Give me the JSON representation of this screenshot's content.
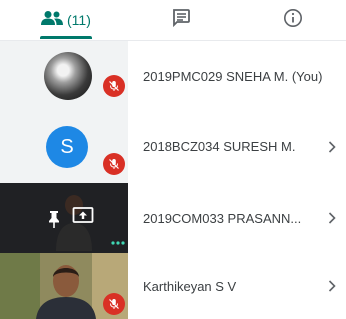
{
  "tabs": {
    "people_count": "(11)",
    "active": "people"
  },
  "colors": {
    "accent": "#00796b",
    "muted_badge": "#d93025",
    "avatar_blue": "#1e88e5"
  },
  "participants": [
    {
      "name": "2019PMC029 SNEHA M. (You)",
      "muted": true,
      "avatar": "photo"
    },
    {
      "name": "2018BCZ034 SURESH M.",
      "muted": true,
      "avatar": "letter",
      "avatar_letter": "S"
    },
    {
      "name": "2019COM033 PRASANN...",
      "muted": false,
      "avatar": "presenting"
    },
    {
      "name": "Karthikeyan S V",
      "muted": true,
      "avatar": "video"
    }
  ]
}
